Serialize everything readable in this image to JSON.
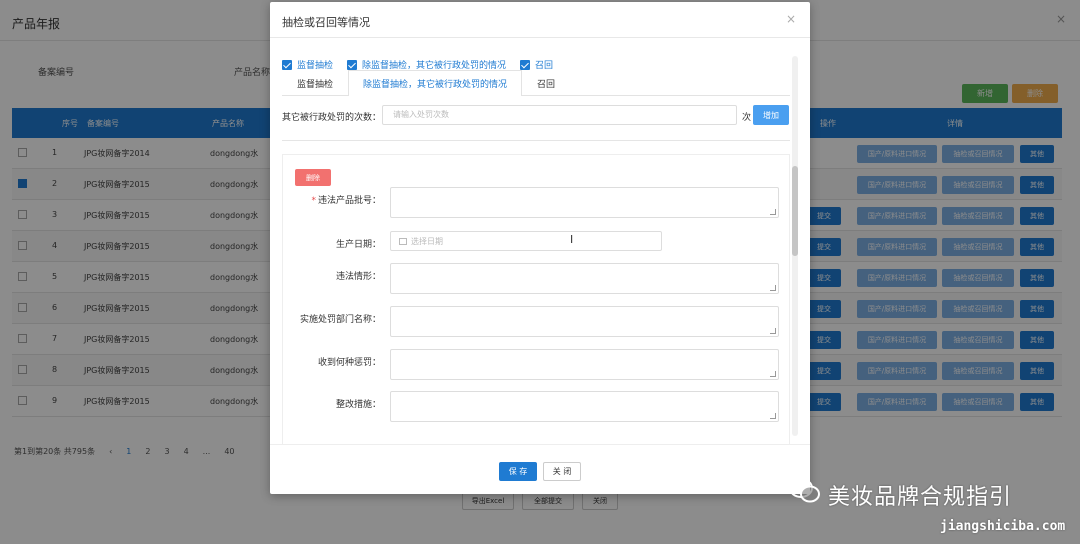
{
  "background": {
    "title": "产品年报",
    "close": "×",
    "filters": [
      "备案编号",
      "产品名称"
    ],
    "buttons": {
      "add": "新增",
      "delete": "删除"
    },
    "table": {
      "headers": [
        "",
        "序号",
        "备案编号",
        "产品名称",
        "操作",
        "详情"
      ],
      "rows": [
        {
          "num": "1",
          "code": "JPG妆网备字2014",
          "name": "dongdong水"
        },
        {
          "num": "2",
          "code": "JPG妆网备字2015",
          "name": "dongdong水"
        },
        {
          "num": "3",
          "code": "JPG妆网备字2015",
          "name": "dongdong水"
        },
        {
          "num": "4",
          "code": "JPG妆网备字2015",
          "name": "dongdong水"
        },
        {
          "num": "5",
          "code": "JPG妆网备字2015",
          "name": "dongdong水"
        },
        {
          "num": "6",
          "code": "JPG妆网备字2015",
          "name": "dongdong水"
        },
        {
          "num": "7",
          "code": "JPG妆网备字2015",
          "name": "dongdong水"
        },
        {
          "num": "8",
          "code": "JPG妆网备字2015",
          "name": "dongdong水"
        },
        {
          "num": "9",
          "code": "JPG妆网备字2015",
          "name": "dongdong水"
        }
      ],
      "row_buttons": {
        "submit": "提交",
        "link1": "国产/原料进口情况",
        "link2": "抽检或召回情况",
        "other": "其他"
      }
    },
    "pager": {
      "summary": "第1到第20条 共795条",
      "prev": "‹",
      "pages": [
        "1",
        "2",
        "3",
        "4",
        "...",
        "40"
      ]
    },
    "bottom_buttons": [
      "导出Excel",
      "全部提交",
      "关闭"
    ]
  },
  "modal": {
    "title": "抽检或召回等情况",
    "close": "×",
    "checks": [
      "监督抽检",
      "除监督抽检，其它被行政处罚的情况",
      "召回"
    ],
    "tabs": [
      "监督抽检",
      "除监督抽检，其它被行政处罚的情况",
      "召回"
    ],
    "times_label": "其它被行政处罚的次数：",
    "times_placeholder": "请输入处罚次数",
    "times_unit": "次",
    "add_label": "增加",
    "delete_label": "删除",
    "fields": {
      "batch": "违法产品批号：",
      "date": "生产日期：",
      "date_placeholder": "选择日期",
      "situation": "违法情形：",
      "dept": "实施处罚部门名称：",
      "penalty": "收到何种惩罚：",
      "measures": "整改措施："
    },
    "save": "保 存",
    "close_btn": "关 闭"
  },
  "watermark": {
    "text": "美妆品牌合规指引",
    "url": "jiangshiciba.com"
  }
}
